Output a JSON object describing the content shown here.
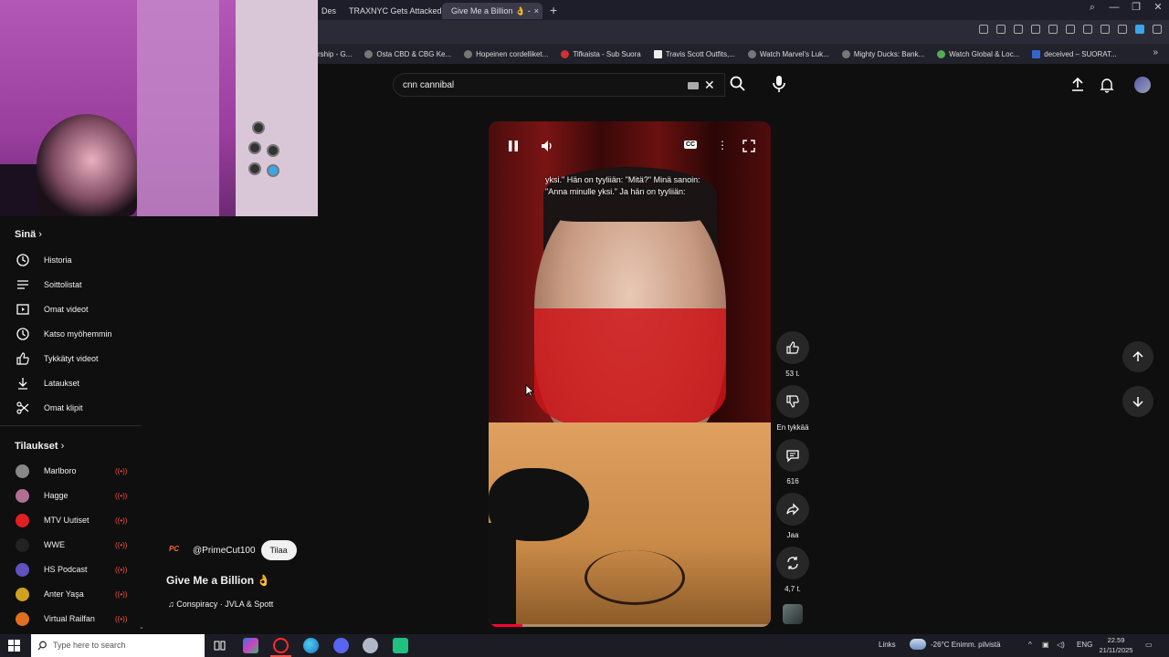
{
  "browser": {
    "tabs": [
      {
        "label": "Des"
      },
      {
        "label": "TRAXNYC Gets Attacked b"
      },
      {
        "label": "Give Me a Billion 👌 -"
      }
    ],
    "new_tab": "+",
    "bookmarks": [
      "rship - G...",
      "Osta CBD & CBG Ke...",
      "Hopeinen cordelliket...",
      "Tifkaista - Sub Suora",
      "Travis Scott Outfits,...",
      "Watch Marvel's Luk...",
      "Mighty Ducks: Bank...",
      "Watch Global & Loc...",
      "deceived – SUORAT..."
    ],
    "bookmarks_more": "»"
  },
  "search": {
    "value": "cnn cannibal"
  },
  "sidebar": {
    "you_title": "Sinä",
    "you_items": [
      {
        "label": "Historia",
        "icon": "history-icon"
      },
      {
        "label": "Soittolistat",
        "icon": "playlists-icon"
      },
      {
        "label": "Omat videot",
        "icon": "your-videos-icon"
      },
      {
        "label": "Katso myöhemmin",
        "icon": "watch-later-icon"
      },
      {
        "label": "Tykkätyt videot",
        "icon": "liked-videos-icon"
      },
      {
        "label": "Lataukset",
        "icon": "downloads-icon"
      },
      {
        "label": "Omat klipit",
        "icon": "clips-icon"
      }
    ],
    "subs_title": "Tilaukset",
    "subs": [
      {
        "label": "Marlboro",
        "color": "#888888"
      },
      {
        "label": "Hagge",
        "color": "#b07090"
      },
      {
        "label": "MTV Uutiset",
        "color": "#e02020"
      },
      {
        "label": "WWE",
        "color": "#222222"
      },
      {
        "label": "HS Podcast",
        "color": "#6050c0"
      },
      {
        "label": "Anter Yaşa",
        "color": "#d0a020"
      },
      {
        "label": "Virtual Railfan",
        "color": "#e07020"
      }
    ]
  },
  "short": {
    "caption_line1": "yksi.\" Hän on tyyliiän: \"Mitä?\" Minä sanoin:",
    "caption_line2": "\"Anna minulle yksi.\" Ja hän on tyyliiän:",
    "cc_label": "CC",
    "progress": 0.12,
    "channel_logo": "PC",
    "channel": "@PrimeCut100",
    "subscribe": "Tilaa",
    "title": "Give Me a Billion 👌",
    "music": "♫ Conspiracy · JVLA & Spott"
  },
  "actions": {
    "likes": "53 t.",
    "dislike": "En tykkää",
    "comments": "616",
    "share": "Jaa",
    "remix": "4,7 t."
  },
  "taskbar": {
    "search_placeholder": "Type here to search",
    "links": "Links",
    "weather": "-26°C  Enimm. pilvistä",
    "lang": "ENG",
    "time": "22.59",
    "date": "21/11/2025"
  },
  "colors": {
    "accent": "#ff0033",
    "background": "#0f0f0f"
  }
}
